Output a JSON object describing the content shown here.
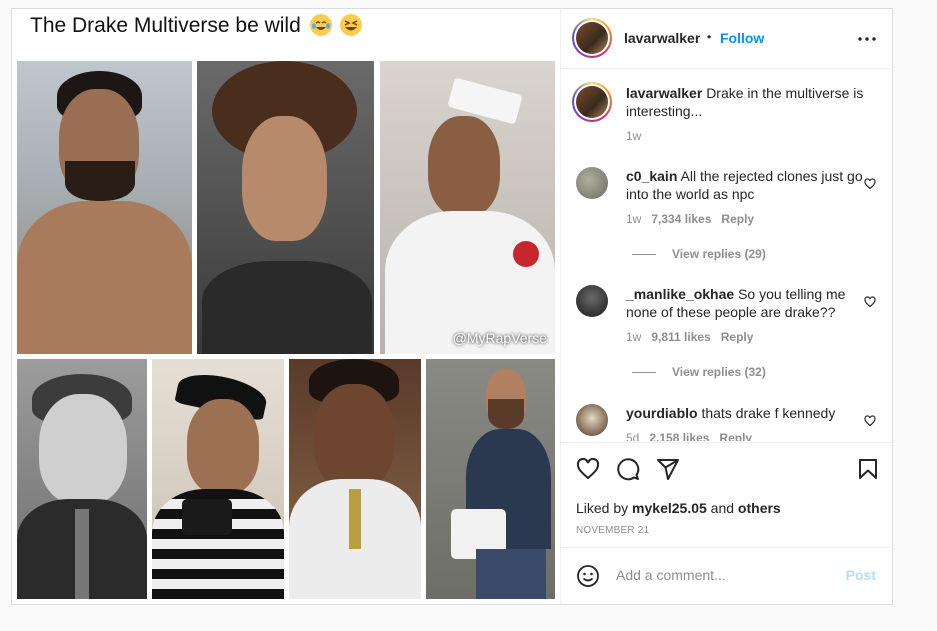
{
  "post": {
    "caption_title": "The Drake Multiverse be wild",
    "watermark": "@MyRapVerse",
    "emojis": [
      "crying-laughing-emoji",
      "grinning-squinting-emoji"
    ]
  },
  "header": {
    "username": "lavarwalker",
    "separator": "•",
    "follow_label": "Follow",
    "more_icon": "more-horizontal-icon"
  },
  "caption": {
    "username": "lavarwalker",
    "text": "Drake in the multiverse is interesting...",
    "time": "1w"
  },
  "comments": [
    {
      "username": "c0_kain",
      "text": "All the rejected clones just go into the world as npc",
      "time": "1w",
      "likes": "7,334 likes",
      "reply": "Reply",
      "view_replies": "View replies (29)"
    },
    {
      "username": "_manlike_okhae",
      "text": "So you telling me none of these people are drake??",
      "time": "1w",
      "likes": "9,811 likes",
      "reply": "Reply",
      "view_replies": "View replies (32)"
    },
    {
      "username": "yourdiablo",
      "text": "thats drake f kennedy",
      "time": "5d",
      "likes": "2,158 likes",
      "reply": "Reply"
    }
  ],
  "actions": {
    "liked_prefix": "Liked by",
    "liked_user": "mykel25.05",
    "liked_and": "and",
    "liked_others": "others",
    "date": "NOVEMBER 21"
  },
  "add_comment": {
    "placeholder": "Add a comment...",
    "post_label": "Post"
  },
  "colors": {
    "accent": "#0095f6",
    "post_disabled": "#b2dffc",
    "text": "#262626",
    "muted": "#8e8e8e"
  }
}
